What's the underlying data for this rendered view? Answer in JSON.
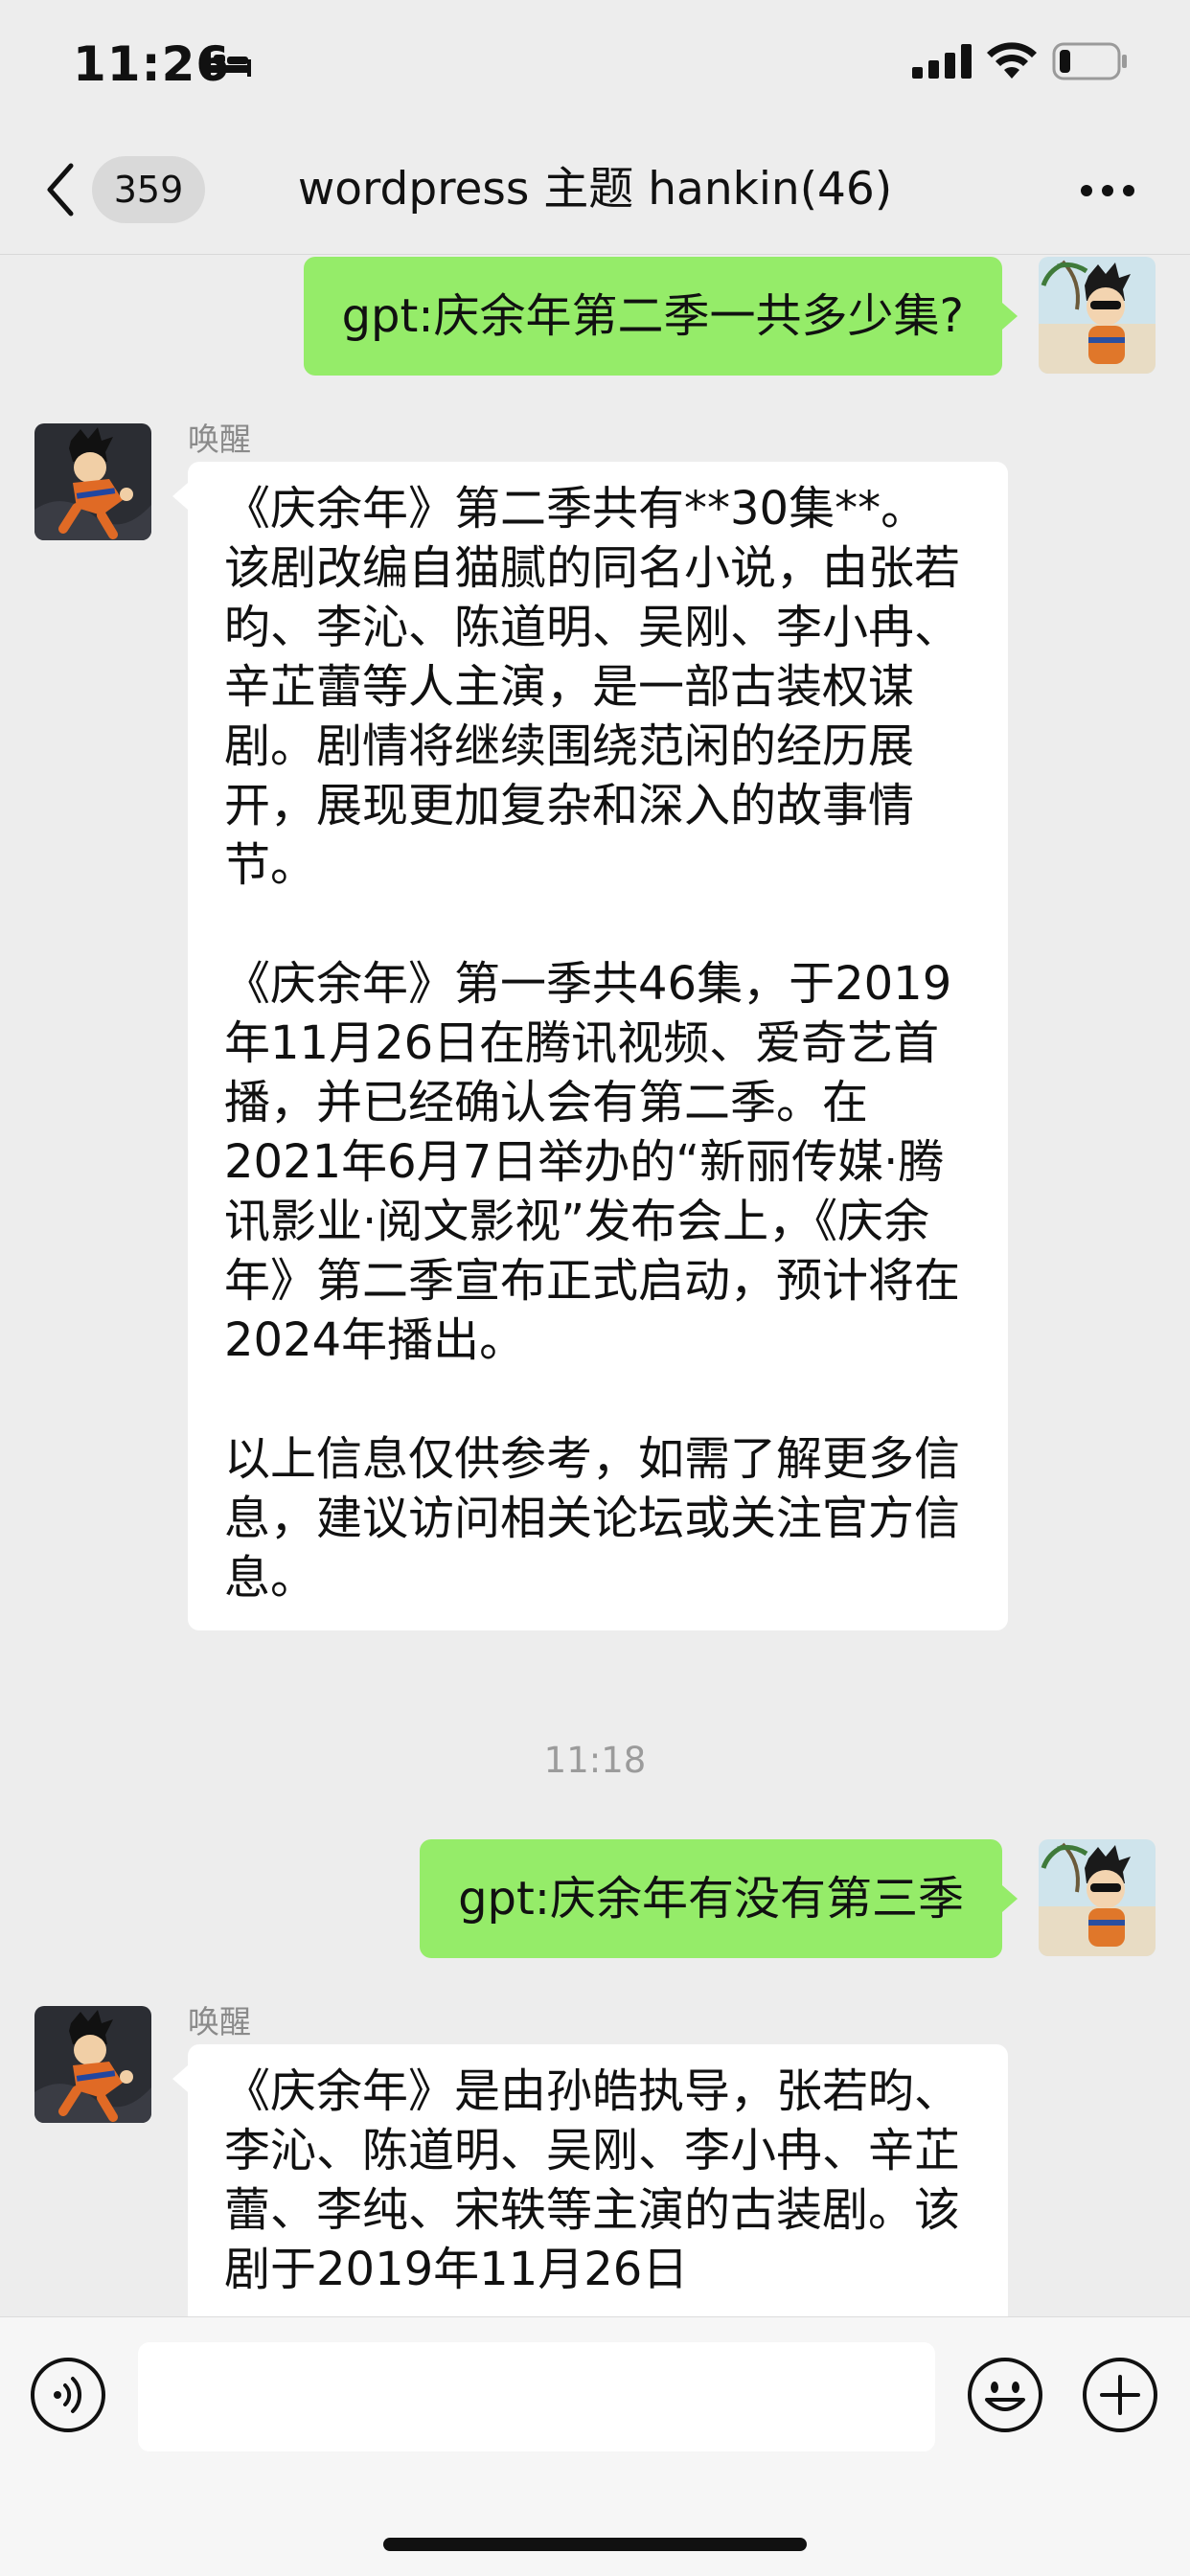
{
  "status_bar": {
    "time": "11:26",
    "sleep_icon": "bed-icon",
    "signal_icon": "cellular-signal-icon",
    "wifi_icon": "wifi-icon",
    "battery_icon": "battery-icon",
    "battery_level": 0.2
  },
  "nav": {
    "back_icon": "chevron-left-icon",
    "unread_count": "359",
    "title": "wordpress 主题 hankin(46)",
    "more_icon": "more-dots-icon"
  },
  "messages": [
    {
      "direction": "outgoing",
      "text": "gpt:庆余年第二季一共多少集?"
    },
    {
      "direction": "incoming",
      "sender": "唤醒",
      "paragraphs": [
        "《庆余年》第二季共有**30集**。该剧改编自猫腻的同名小说，由张若昀、李沁、陈道明、吴刚、李小冉、辛芷蕾等人主演，是一部古装权谋剧。剧情将继续围绕范闲的经历展开，展现更加复杂和深入的故事情节。",
        "《庆余年》第一季共46集，于2019年11月26日在腾讯视频、爱奇艺首播，并已经确认会有第二季。在2021年6月7日举办的“新丽传媒·腾讯影业·阅文影视”发布会上，《庆余年》第二季宣布正式启动，预计将在2024年播出。",
        "以上信息仅供参考，如需了解更多信息，建议访问相关论坛或关注官方信息。"
      ]
    },
    {
      "direction": "divider",
      "time": "11:18"
    },
    {
      "direction": "outgoing",
      "text": "gpt:庆余年有没有第三季"
    },
    {
      "direction": "incoming",
      "sender": "唤醒",
      "paragraphs": [
        "《庆余年》是由孙皓执导，张若昀、李沁、陈道明、吴刚、李小冉、辛芷蕾、李纯、宋轶等主演的古装剧。该剧于2019年11月26日"
      ]
    }
  ],
  "input_bar": {
    "voice_icon": "voice-input-icon",
    "input_value": "",
    "emoji_icon": "emoji-smile-icon",
    "plus_icon": "plus-circle-icon"
  },
  "colors": {
    "background": "#ededed",
    "outgoing_bubble": "#95ec69",
    "incoming_bubble": "#ffffff",
    "secondary_text": "#8a8a8a"
  }
}
